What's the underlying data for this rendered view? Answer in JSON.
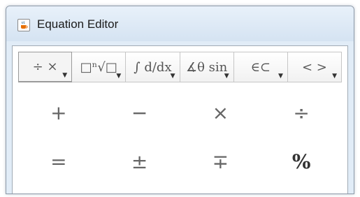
{
  "window": {
    "title": "Equation Editor",
    "app_icon": "java-cup-icon"
  },
  "toolbar": {
    "tabs": [
      {
        "label": "÷ ×"
      },
      {
        "label": "□ⁿ√□"
      },
      {
        "label": "∫ d/dx"
      },
      {
        "label": "∡θ sin"
      },
      {
        "label": "∈⊂"
      },
      {
        "label": "< >"
      }
    ],
    "active_index": 0
  },
  "symbols": [
    {
      "label": "+"
    },
    {
      "label": "−"
    },
    {
      "label": "×"
    },
    {
      "label": "÷"
    },
    {
      "label": "="
    },
    {
      "label": "±"
    },
    {
      "label": "∓"
    },
    {
      "label": "%"
    }
  ]
}
